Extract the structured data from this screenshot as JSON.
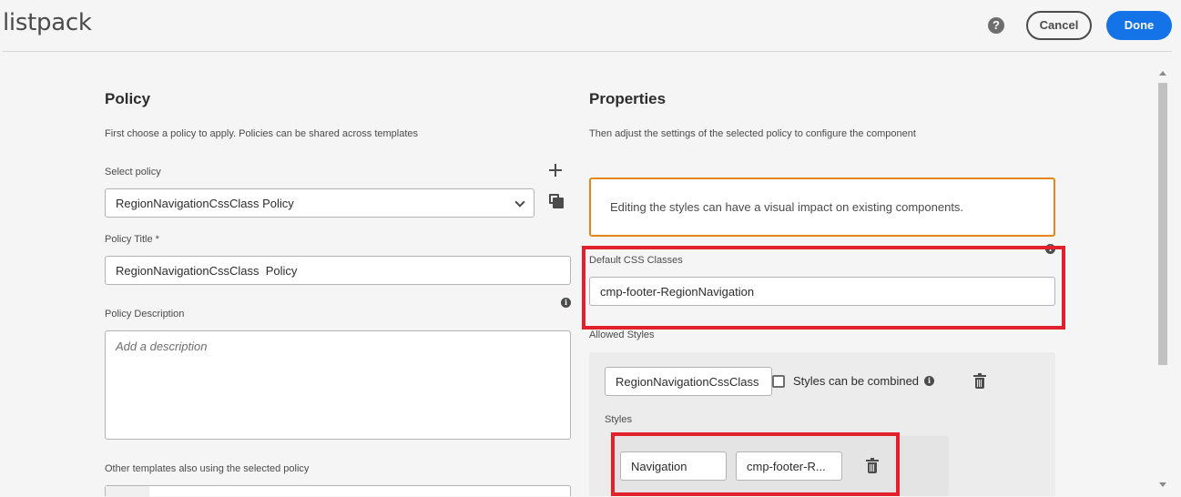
{
  "header": {
    "title": "listpack",
    "help_icon": "question-circle-icon",
    "cancel_label": "Cancel",
    "done_label": "Done"
  },
  "policy": {
    "heading": "Policy",
    "description": "First choose a policy to apply. Policies can be shared across templates",
    "select_label": "Select policy",
    "select_value": "RegionNavigationCssClass Policy",
    "title_label": "Policy Title *",
    "title_value": "RegionNavigationCssClass  Policy",
    "description_label": "Policy Description",
    "description_placeholder": "Add a description",
    "other_templates_label": "Other templates also using the selected policy"
  },
  "properties": {
    "heading": "Properties",
    "description": "Then adjust the settings of the selected policy to configure the component",
    "warning": "Editing the styles can have a visual impact on existing components.",
    "default_css_label": "Default CSS Classes",
    "default_css_value": "cmp-footer-RegionNavigation",
    "allowed_styles_label": "Allowed Styles",
    "group_name_value": "RegionNavigationCssClass",
    "combined_label": "Styles can be combined",
    "combined_checked": false,
    "styles_label": "Styles",
    "style_name_value": "Navigation",
    "style_class_value": "cmp-footer-R..."
  },
  "colors": {
    "primary": "#1473e6",
    "warning_border": "#e68619",
    "highlight": "#e1222c"
  }
}
